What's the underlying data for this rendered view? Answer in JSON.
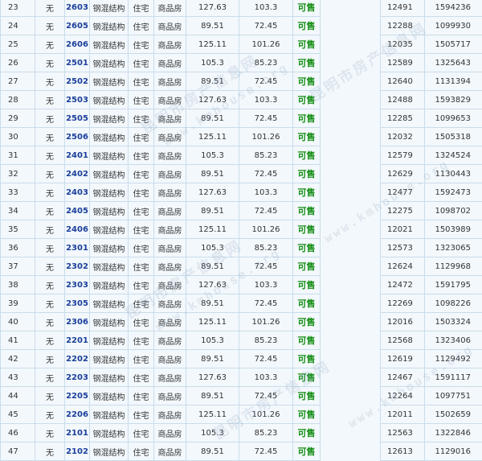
{
  "watermark": {
    "text_cn": "昆明市房产信息网",
    "text_url": "www.kmhouse.org"
  },
  "rows": [
    {
      "no": "23",
      "mark": "无",
      "room": "2603",
      "structure": "钢混结构",
      "use": "住宅",
      "type": "商品房",
      "area1": "127.63",
      "area2": "103.3",
      "status": "可售",
      "price": "12491",
      "total": "1594236"
    },
    {
      "no": "24",
      "mark": "无",
      "room": "2605",
      "structure": "钢混结构",
      "use": "住宅",
      "type": "商品房",
      "area1": "89.51",
      "area2": "72.45",
      "status": "可售",
      "price": "12288",
      "total": "1099930"
    },
    {
      "no": "25",
      "mark": "无",
      "room": "2606",
      "structure": "钢混结构",
      "use": "住宅",
      "type": "商品房",
      "area1": "125.11",
      "area2": "101.26",
      "status": "可售",
      "price": "12035",
      "total": "1505717"
    },
    {
      "no": "26",
      "mark": "无",
      "room": "2501",
      "structure": "钢混结构",
      "use": "住宅",
      "type": "商品房",
      "area1": "105.3",
      "area2": "85.23",
      "status": "可售",
      "price": "12589",
      "total": "1325643"
    },
    {
      "no": "27",
      "mark": "无",
      "room": "2502",
      "structure": "钢混结构",
      "use": "住宅",
      "type": "商品房",
      "area1": "89.51",
      "area2": "72.45",
      "status": "可售",
      "price": "12640",
      "total": "1131394"
    },
    {
      "no": "28",
      "mark": "无",
      "room": "2503",
      "structure": "钢混结构",
      "use": "住宅",
      "type": "商品房",
      "area1": "127.63",
      "area2": "103.3",
      "status": "可售",
      "price": "12488",
      "total": "1593829"
    },
    {
      "no": "29",
      "mark": "无",
      "room": "2505",
      "structure": "钢混结构",
      "use": "住宅",
      "type": "商品房",
      "area1": "89.51",
      "area2": "72.45",
      "status": "可售",
      "price": "12285",
      "total": "1099653"
    },
    {
      "no": "30",
      "mark": "无",
      "room": "2506",
      "structure": "钢混结构",
      "use": "住宅",
      "type": "商品房",
      "area1": "125.11",
      "area2": "101.26",
      "status": "可售",
      "price": "12032",
      "total": "1505318"
    },
    {
      "no": "31",
      "mark": "无",
      "room": "2401",
      "structure": "钢混结构",
      "use": "住宅",
      "type": "商品房",
      "area1": "105.3",
      "area2": "85.23",
      "status": "可售",
      "price": "12579",
      "total": "1324524"
    },
    {
      "no": "32",
      "mark": "无",
      "room": "2402",
      "structure": "钢混结构",
      "use": "住宅",
      "type": "商品房",
      "area1": "89.51",
      "area2": "72.45",
      "status": "可售",
      "price": "12629",
      "total": "1130443"
    },
    {
      "no": "33",
      "mark": "无",
      "room": "2403",
      "structure": "钢混结构",
      "use": "住宅",
      "type": "商品房",
      "area1": "127.63",
      "area2": "103.3",
      "status": "可售",
      "price": "12477",
      "total": "1592473"
    },
    {
      "no": "34",
      "mark": "无",
      "room": "2405",
      "structure": "钢混结构",
      "use": "住宅",
      "type": "商品房",
      "area1": "89.51",
      "area2": "72.45",
      "status": "可售",
      "price": "12275",
      "total": "1098702"
    },
    {
      "no": "35",
      "mark": "无",
      "room": "2406",
      "structure": "钢混结构",
      "use": "住宅",
      "type": "商品房",
      "area1": "125.11",
      "area2": "101.26",
      "status": "可售",
      "price": "12021",
      "total": "1503989"
    },
    {
      "no": "36",
      "mark": "无",
      "room": "2301",
      "structure": "钢混结构",
      "use": "住宅",
      "type": "商品房",
      "area1": "105.3",
      "area2": "85.23",
      "status": "可售",
      "price": "12573",
      "total": "1323065"
    },
    {
      "no": "37",
      "mark": "无",
      "room": "2302",
      "structure": "钢混结构",
      "use": "住宅",
      "type": "商品房",
      "area1": "89.51",
      "area2": "72.45",
      "status": "可售",
      "price": "12624",
      "total": "1129968"
    },
    {
      "no": "38",
      "mark": "无",
      "room": "2303",
      "structure": "钢混结构",
      "use": "住宅",
      "type": "商品房",
      "area1": "127.63",
      "area2": "103.3",
      "status": "可售",
      "price": "12472",
      "total": "1591795"
    },
    {
      "no": "39",
      "mark": "无",
      "room": "2305",
      "structure": "钢混结构",
      "use": "住宅",
      "type": "商品房",
      "area1": "89.51",
      "area2": "72.45",
      "status": "可售",
      "price": "12269",
      "total": "1098226"
    },
    {
      "no": "40",
      "mark": "无",
      "room": "2306",
      "structure": "钢混结构",
      "use": "住宅",
      "type": "商品房",
      "area1": "125.11",
      "area2": "101.26",
      "status": "可售",
      "price": "12016",
      "total": "1503324"
    },
    {
      "no": "41",
      "mark": "无",
      "room": "2201",
      "structure": "钢混结构",
      "use": "住宅",
      "type": "商品房",
      "area1": "105.3",
      "area2": "85.23",
      "status": "可售",
      "price": "12568",
      "total": "1323406"
    },
    {
      "no": "42",
      "mark": "无",
      "room": "2202",
      "structure": "钢混结构",
      "use": "住宅",
      "type": "商品房",
      "area1": "89.51",
      "area2": "72.45",
      "status": "可售",
      "price": "12619",
      "total": "1129492"
    },
    {
      "no": "43",
      "mark": "无",
      "room": "2203",
      "structure": "钢混结构",
      "use": "住宅",
      "type": "商品房",
      "area1": "127.63",
      "area2": "103.3",
      "status": "可售",
      "price": "12467",
      "total": "1591117"
    },
    {
      "no": "44",
      "mark": "无",
      "room": "2205",
      "structure": "钢混结构",
      "use": "住宅",
      "type": "商品房",
      "area1": "89.51",
      "area2": "72.45",
      "status": "可售",
      "price": "12264",
      "total": "1097751"
    },
    {
      "no": "45",
      "mark": "无",
      "room": "2206",
      "structure": "钢混结构",
      "use": "住宅",
      "type": "商品房",
      "area1": "125.11",
      "area2": "101.26",
      "status": "可售",
      "price": "12011",
      "total": "1502659"
    },
    {
      "no": "46",
      "mark": "无",
      "room": "2101",
      "structure": "钢混结构",
      "use": "住宅",
      "type": "商品房",
      "area1": "105.3",
      "area2": "85.23",
      "status": "可售",
      "price": "12563",
      "total": "1322846"
    },
    {
      "no": "47",
      "mark": "无",
      "room": "2102",
      "structure": "钢混结构",
      "use": "住宅",
      "type": "商品房",
      "area1": "89.51",
      "area2": "72.45",
      "status": "可售",
      "price": "12613",
      "total": "1129016"
    }
  ]
}
